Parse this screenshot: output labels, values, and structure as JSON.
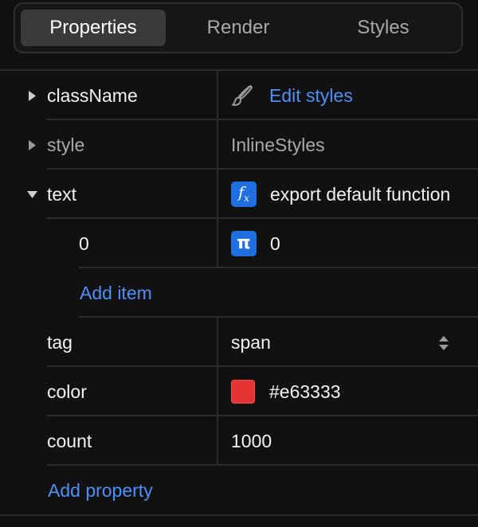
{
  "tabs": [
    {
      "label": "Properties",
      "active": true
    },
    {
      "label": "Render",
      "active": false
    },
    {
      "label": "Styles",
      "active": false
    }
  ],
  "properties": {
    "className": {
      "key": "className",
      "value": "Edit styles",
      "icon": "brush-icon"
    },
    "style": {
      "key": "style",
      "value": "InlineStyles"
    },
    "text": {
      "key": "text",
      "value": "export default function",
      "icon": "function-icon",
      "items": [
        {
          "key": "0",
          "value": "0",
          "icon": "pi-icon"
        }
      ],
      "add_item_label": "Add item"
    },
    "tag": {
      "key": "tag",
      "value": "span"
    },
    "color": {
      "key": "color",
      "value": "#e63333",
      "swatch": "#e63333"
    },
    "count": {
      "key": "count",
      "value": "1000"
    }
  },
  "add_property_label": "Add property",
  "colors": {
    "accent": "#4f8ff7",
    "icon_bg": "#1f6fe0",
    "background": "#111111"
  }
}
